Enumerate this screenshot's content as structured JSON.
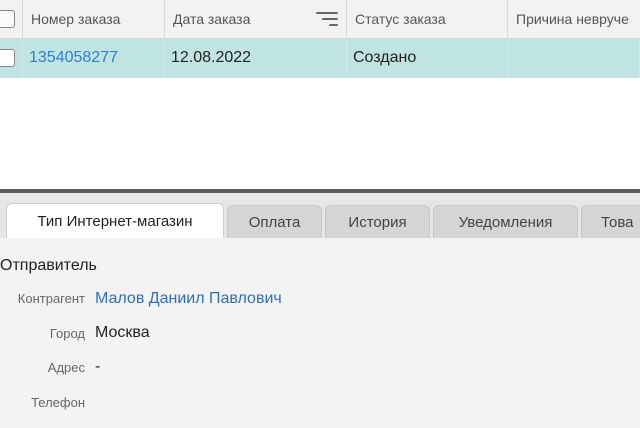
{
  "grid": {
    "columns": [
      "Номер заказа",
      "Дата заказа",
      "Статус заказа",
      "Причина невруче"
    ],
    "rows": [
      {
        "order_number": "1354058277",
        "order_date": "12.08.2022",
        "status": "Создано",
        "reason": ""
      }
    ]
  },
  "tabs": [
    "Тип Интернет-магазин",
    "Оплата",
    "История",
    "Уведомления",
    "Това"
  ],
  "details": {
    "section_title": "Отправитель",
    "fields": [
      {
        "label": "Контрагент",
        "value": "Малов Даниил Павлович"
      },
      {
        "label": "Город",
        "value": "Москва"
      },
      {
        "label": "Адрес",
        "value": "-"
      },
      {
        "label": "Телефон",
        "value": ""
      }
    ]
  },
  "colors": {
    "selected_row": "#bfe4e2",
    "link": "#2f7fd1",
    "header_bg": "#f2f2f2",
    "panel_bg": "#f3f3f3",
    "tab_strip_bg": "#e6e6e6"
  },
  "icons": {
    "header_checkbox": "checkbox-icon",
    "column_filter": "filter-icon",
    "row_checkbox": "checkbox-icon"
  }
}
